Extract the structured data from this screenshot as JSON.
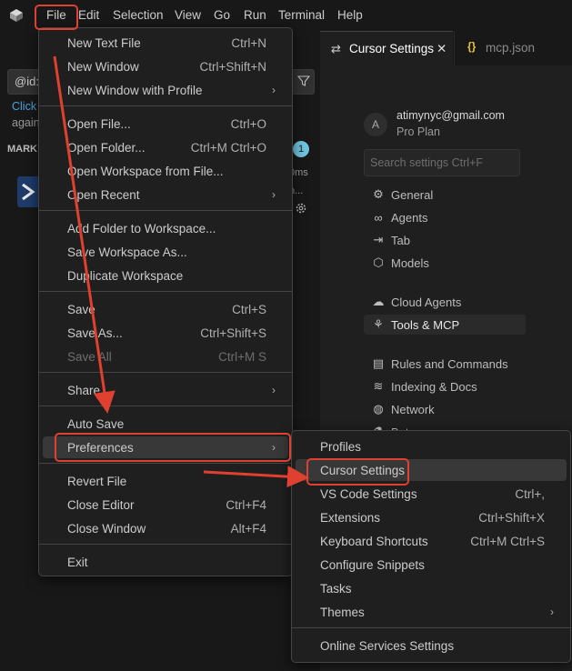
{
  "menubar": {
    "items": [
      "File",
      "Edit",
      "Selection",
      "View",
      "Go",
      "Run",
      "Terminal",
      "Help"
    ]
  },
  "tabs": [
    {
      "label": "Cursor Settings",
      "icon": "settings-lines-icon",
      "active": true
    },
    {
      "label": "mcp.json",
      "icon": "json-braces-icon",
      "active": false
    }
  ],
  "left_panel": {
    "search_value": "@id:",
    "link_text": "Click",
    "text_again": "again",
    "heading": "MARK",
    "badge": "1",
    "ms": "0ms",
    "ellipsis": "h..."
  },
  "account": {
    "avatar_letter": "A",
    "email": "atimynyc@gmail.com",
    "plan": "Pro Plan",
    "search_placeholder": "Search settings Ctrl+F"
  },
  "settings_nav": [
    {
      "label": "General",
      "icon": "gear-icon"
    },
    {
      "label": "Agents",
      "icon": "infinity-icon"
    },
    {
      "label": "Tab",
      "icon": "tab-arrow-icon"
    },
    {
      "label": "Models",
      "icon": "cube-icon"
    },
    {
      "label": "Cloud Agents",
      "icon": "cloud-icon"
    },
    {
      "label": "Tools & MCP",
      "icon": "tools-icon",
      "selected": true
    },
    {
      "label": "Rules and Commands",
      "icon": "clipboard-icon"
    },
    {
      "label": "Indexing & Docs",
      "icon": "database-icon"
    },
    {
      "label": "Network",
      "icon": "globe-icon"
    },
    {
      "label": "Bet",
      "icon": "flask-icon"
    }
  ],
  "file_menu": {
    "items": [
      {
        "label": "New Text File",
        "key": "Ctrl+N"
      },
      {
        "label": "New Window",
        "key": "Ctrl+Shift+N"
      },
      {
        "label": "New Window with Profile",
        "submenu": true
      },
      {
        "label": "Open File...",
        "key": "Ctrl+O"
      },
      {
        "label": "Open Folder...",
        "key": "Ctrl+M Ctrl+O"
      },
      {
        "label": "Open Workspace from File..."
      },
      {
        "label": "Open Recent",
        "submenu": true
      },
      {
        "label": "Add Folder to Workspace..."
      },
      {
        "label": "Save Workspace As..."
      },
      {
        "label": "Duplicate Workspace"
      },
      {
        "label": "Save",
        "key": "Ctrl+S"
      },
      {
        "label": "Save As...",
        "key": "Ctrl+Shift+S"
      },
      {
        "label": "Save All",
        "key": "Ctrl+M S",
        "disabled": true
      },
      {
        "label": "Share",
        "submenu": true
      },
      {
        "label": "Auto Save"
      },
      {
        "label": "Preferences",
        "submenu": true,
        "highlighted": true
      },
      {
        "label": "Revert File"
      },
      {
        "label": "Close Editor",
        "key": "Ctrl+F4"
      },
      {
        "label": "Close Window",
        "key": "Alt+F4"
      },
      {
        "label": "Exit"
      }
    ]
  },
  "preferences_menu": {
    "items": [
      {
        "label": "Profiles"
      },
      {
        "label": "Cursor Settings",
        "highlighted": true
      },
      {
        "label": "VS Code Settings",
        "key": "Ctrl+,"
      },
      {
        "label": "Extensions",
        "key": "Ctrl+Shift+X"
      },
      {
        "label": "Keyboard Shortcuts",
        "key": "Ctrl+M Ctrl+S"
      },
      {
        "label": "Configure Snippets"
      },
      {
        "label": "Tasks"
      },
      {
        "label": "Themes",
        "submenu": true
      },
      {
        "label": "Online Services Settings"
      }
    ]
  },
  "arrow_glyph": "›",
  "close_glyph": "✕",
  "colors": {
    "annotation_red": "#e0402f",
    "menu_bg": "#1f1f1f",
    "highlight_bg": "#383838",
    "badge_bg": "#6fc3df"
  }
}
